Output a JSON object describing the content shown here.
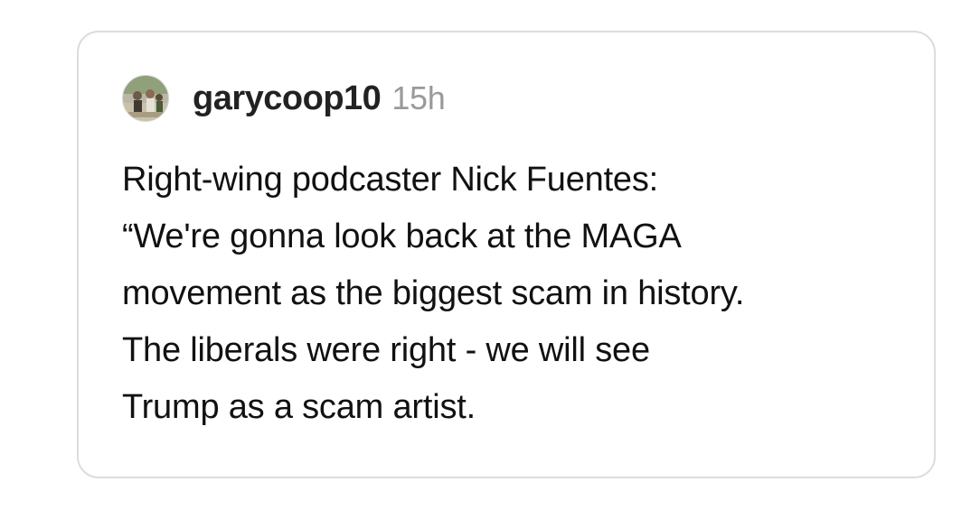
{
  "post": {
    "author": {
      "username": "garycoop10",
      "avatar_icon": "user-avatar-photo"
    },
    "timestamp": "15h",
    "text_lines": [
      "Right-wing podcaster Nick Fuentes:",
      "“We're gonna look back at the MAGA",
      "movement as the biggest scam in history.",
      "The liberals were right - we will see",
      "Trump as a scam artist."
    ]
  },
  "colors": {
    "card_border": "#dcdcdc",
    "username": "#222222",
    "timestamp": "#9a9a9a",
    "text": "#111111"
  }
}
